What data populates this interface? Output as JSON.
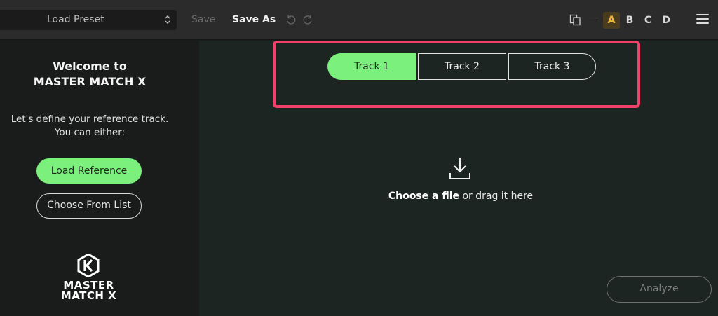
{
  "toolbar": {
    "preset_label": "Load Preset",
    "save_label": "Save",
    "save_as_label": "Save As",
    "slots": [
      "A",
      "B",
      "C",
      "D"
    ],
    "active_slot": "A"
  },
  "sidebar": {
    "welcome_line1": "Welcome to",
    "welcome_line2": "MASTER MATCH X",
    "desc_line1": "Let's define your reference track.",
    "desc_line2": "You can either:",
    "load_reference_label": "Load Reference",
    "choose_from_list_label": "Choose From List",
    "logo_line1": "MASTER",
    "logo_line2": "MATCH X"
  },
  "main": {
    "tabs": [
      {
        "label": "Track 1",
        "active": true
      },
      {
        "label": "Track 2",
        "active": false
      },
      {
        "label": "Track 3",
        "active": false
      }
    ],
    "drop_strong": "Choose a file",
    "drop_rest": "or drag it here",
    "analyze_label": "Analyze"
  },
  "colors": {
    "accent_green": "#7cf07c",
    "highlight": "#f0416b",
    "slot_active": "#f2b53a"
  },
  "icons": [
    "chevron-updown-icon",
    "undo-icon",
    "redo-icon",
    "copy-icon",
    "menu-icon",
    "download-icon",
    "logo-icon"
  ]
}
